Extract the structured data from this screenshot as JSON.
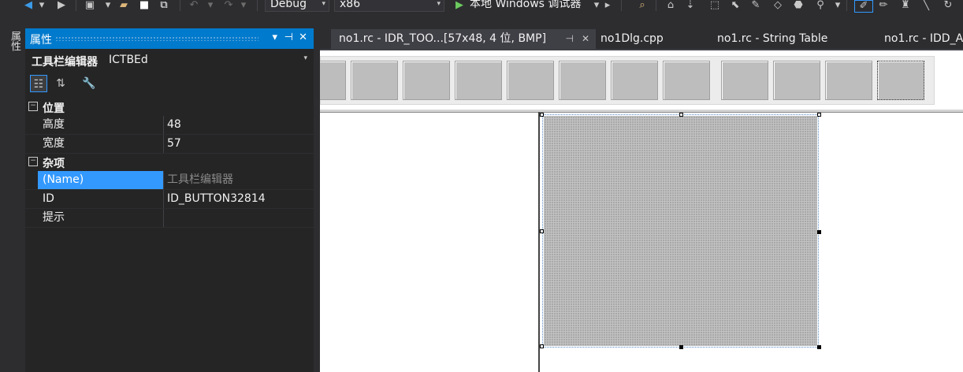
{
  "toolbar": {
    "config": "Debug",
    "platform": "x86",
    "run_label": "本地 Windows 调试器",
    "config_arrow": "▾",
    "platform_arrow": "▾"
  },
  "side_tab": {
    "label": "属性"
  },
  "properties": {
    "title": "属性",
    "pin_glyph": "▾ ⊣ ✕",
    "object_name": "工具栏编辑器",
    "object_type": "ICTBEd",
    "categories": [
      {
        "label": "位置",
        "rows": [
          {
            "key": "高度",
            "value": "48"
          },
          {
            "key": "宽度",
            "value": "57"
          }
        ]
      },
      {
        "label": "杂项",
        "rows": [
          {
            "key": "(Name)",
            "value": "工具栏编辑器",
            "selected": true
          },
          {
            "key": "ID",
            "value": "ID_BUTTON32814"
          },
          {
            "key": "提示",
            "value": ""
          }
        ]
      }
    ]
  },
  "tabs": [
    {
      "label": "no1.rc - IDR_TOO...[57x48, 4 位, BMP]",
      "active": true
    },
    {
      "label": "no1Dlg.cpp"
    },
    {
      "label": "no1.rc - String Table"
    },
    {
      "label": "no1.rc - IDD_A"
    }
  ],
  "colors": {
    "accent": "#007acc",
    "selection": "#3399ff",
    "panel_bg": "#252526",
    "window_bg": "#2d2d30"
  }
}
